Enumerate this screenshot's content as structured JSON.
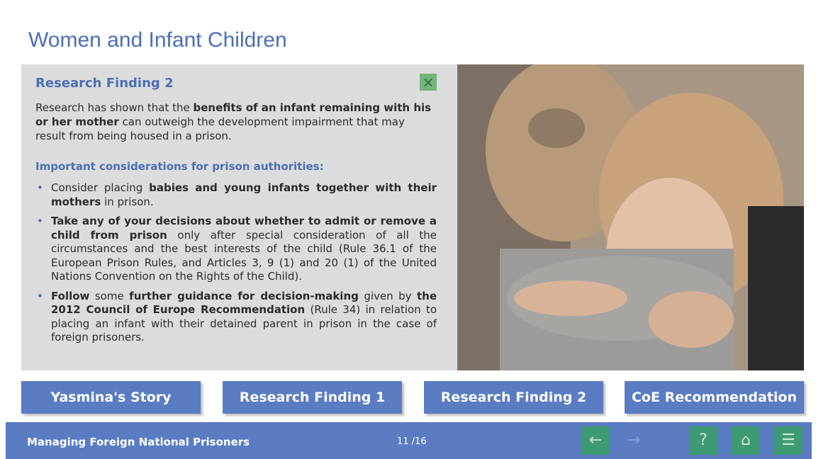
{
  "page": {
    "title": "Women and Infant Children"
  },
  "panel": {
    "heading": "Research Finding 2",
    "close_icon": "×",
    "intro_plain_1": "Research has shown that the ",
    "intro_bold": "benefits of an infant remaining with his or her mother",
    "intro_plain_2": " can outweigh the development impairment that may result from being housed in a prison.",
    "subheading": "Important considerations for prison authorities:",
    "bullets": [
      {
        "a": "Consider placing ",
        "b": "babies and young infants together with their mothers",
        "c": " in prison."
      },
      {
        "a": "",
        "b": "Take any of your decisions about whether to admit or remove a child from prison",
        "c": " only after special consideration of all the circumstances and the best interests of the child (Rule 36.1 of the European Prison Rules, and Articles 3, 9 (1) and 20 (1) of the United Nations Convention on the Rights of the Child)."
      },
      {
        "a": "",
        "b": "Follow",
        "c": " some ",
        "d": "further guidance for decision-making",
        "e": " given by ",
        "f": "the 2012 Council of Europe Recommendation",
        "g": " (Rule 34) in relation to placing an infant with their detained parent in prison in the case of foreign prisoners."
      }
    ]
  },
  "photo": {
    "alt": "Child hugging mother"
  },
  "buttons": {
    "story": "Yasmina's Story",
    "finding1": "Research Finding 1",
    "finding2": "Research Finding 2",
    "coe": "CoE Recommendation"
  },
  "footer": {
    "course_title": "Managing Foreign National Prisoners",
    "page_counter": "11 /16",
    "back_icon": "←",
    "next_icon": "→",
    "help_icon": "?",
    "home_icon": "⌂",
    "menu_icon": "☰"
  },
  "colors": {
    "accent": "#4a6fb4",
    "button_bg": "#5a7cc2",
    "nav_green": "#3d9a72",
    "panel_bg": "#dcdcdc"
  }
}
